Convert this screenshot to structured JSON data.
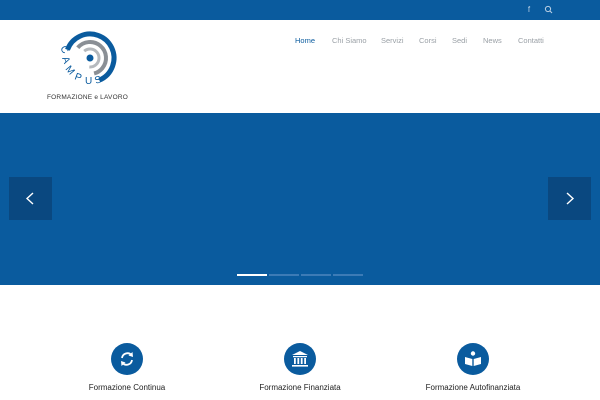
{
  "topbar": {
    "icons": [
      "facebook-icon",
      "search-icon"
    ],
    "facebook_glyph": "f"
  },
  "logo": {
    "wordmark": "CAMPUS",
    "caption": "FORMAZIONE e LAVORO"
  },
  "nav": {
    "items": [
      {
        "label": "Home",
        "active": true
      },
      {
        "label": "Chi Siamo",
        "active": false
      },
      {
        "label": "Servizi",
        "active": false
      },
      {
        "label": "Corsi",
        "active": false
      },
      {
        "label": "Sedi",
        "active": false
      },
      {
        "label": "News",
        "active": false
      },
      {
        "label": "Contatti",
        "active": false
      }
    ]
  },
  "hero": {
    "prev_icon": "chevron-left-icon",
    "next_icon": "chevron-right-icon",
    "slide_count": 4,
    "active_slide": 1
  },
  "features": [
    {
      "title": "Formazione Continua",
      "icon": "refresh-icon"
    },
    {
      "title": "Formazione Finanziata",
      "icon": "bank-icon"
    },
    {
      "title": "Formazione Autofinanziata",
      "icon": "book-icon"
    }
  ],
  "colors": {
    "brand_blue": "#0a5b9e",
    "arrow_bg": "#0a4880",
    "nav_inactive": "#9aa0a6",
    "nav_active": "#0a5b9e"
  }
}
